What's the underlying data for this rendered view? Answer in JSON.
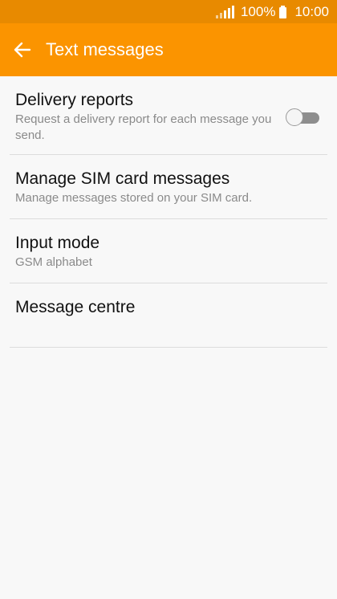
{
  "status_bar": {
    "battery": "100%",
    "time": "10:00",
    "signal_icon": "signal-icon",
    "battery_icon": "battery-icon"
  },
  "app_bar": {
    "title": "Text messages",
    "back_icon": "arrow-left-icon",
    "color": "#fb9400"
  },
  "settings": {
    "delivery_reports": {
      "title": "Delivery reports",
      "summary": "Request a delivery report for each message you send.",
      "enabled": false
    },
    "sim_messages": {
      "title": "Manage SIM card messages",
      "summary": "Manage messages stored on your SIM card."
    },
    "input_mode": {
      "title": "Input mode",
      "summary": "GSM alphabet"
    },
    "message_centre": {
      "title": "Message centre"
    }
  }
}
